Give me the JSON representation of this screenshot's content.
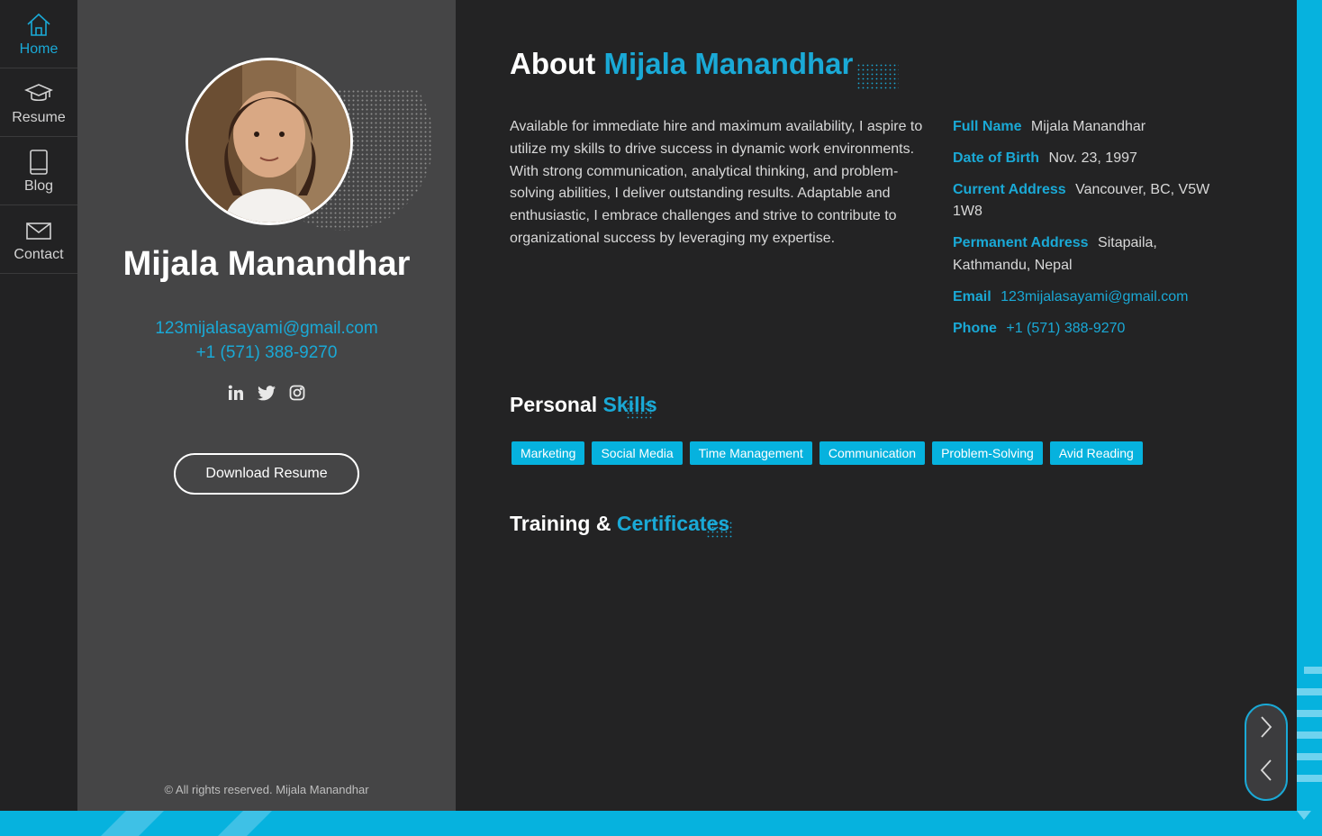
{
  "nav": {
    "items": [
      {
        "label": "Home",
        "icon": "home-icon",
        "active": true
      },
      {
        "label": "Resume",
        "icon": "graduation-cap-icon",
        "active": false
      },
      {
        "label": "Blog",
        "icon": "book-icon",
        "active": false
      },
      {
        "label": "Contact",
        "icon": "envelope-icon",
        "active": false
      }
    ]
  },
  "profile": {
    "name": "Mijala Manandhar",
    "email": "123mijalasayami@gmail.com",
    "phone": "+1 (571) 388-9270",
    "social": [
      "linkedin-icon",
      "twitter-icon",
      "instagram-icon"
    ],
    "download_label": "Download Resume",
    "copyright": "© All rights reserved. Mijala Manandhar"
  },
  "about": {
    "title_prefix": "About",
    "title_accent": "Mijala Manandhar",
    "text": "Available for immediate hire and maximum availability, I aspire to utilize my skills to drive success in dynamic work environments. With strong communication, analytical thinking, and problem-solving abilities, I deliver outstanding results. Adaptable and enthusiastic, I embrace challenges and strive to contribute to organizational success by leveraging my expertise.",
    "info": {
      "full_name_label": "Full Name",
      "full_name": "Mijala Manandhar",
      "dob_label": "Date of Birth",
      "dob": "Nov. 23, 1997",
      "current_address_label": "Current Address",
      "current_address": "Vancouver, BC, V5W 1W8",
      "permanent_address_label": "Permanent Address",
      "permanent_address": "Sitapaila, Kathmandu, Nepal",
      "email_label": "Email",
      "email": "123mijalasayami@gmail.com",
      "phone_label": "Phone",
      "phone": "+1 (571) 388-9270"
    }
  },
  "skills": {
    "title_prefix": "Personal",
    "title_accent": "Skills",
    "items": [
      "Marketing",
      "Social Media",
      "Time Management",
      "Communication",
      "Problem-Solving",
      "Avid Reading"
    ]
  },
  "certificates": {
    "title_prefix": "Training &",
    "title_accent": "Certificates"
  },
  "pager": {
    "next_icon": "chevron-right-icon",
    "prev_icon": "chevron-left-icon"
  },
  "colors": {
    "accent": "#1aa9d6",
    "brand_blue": "#06b2de",
    "nav_bg": "#222223",
    "profile_bg": "#454546",
    "main_bg": "#232324"
  }
}
